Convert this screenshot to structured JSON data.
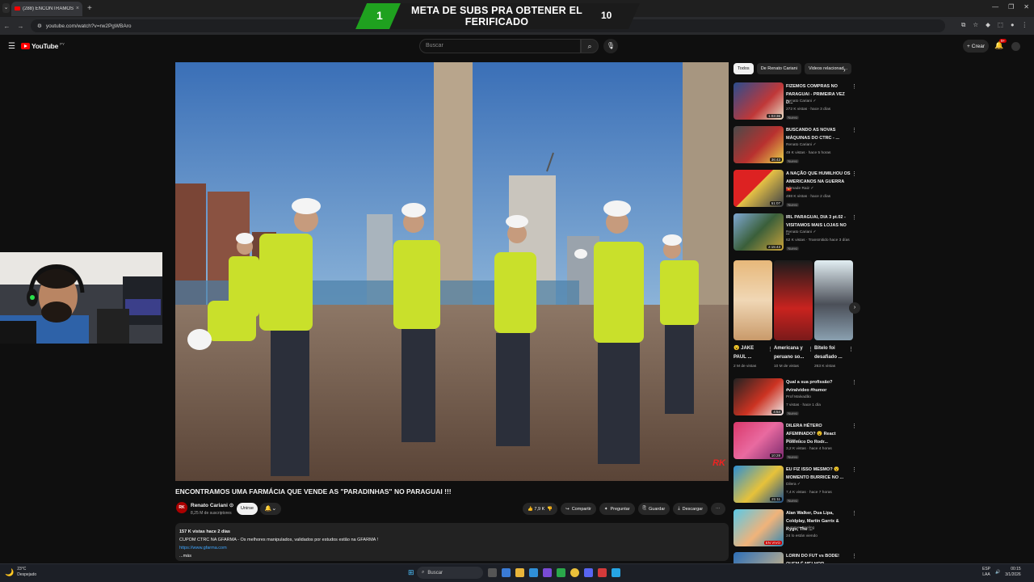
{
  "browser": {
    "tab_title": "(288) ENCONTRAMOS UMA...",
    "tab_close": "×",
    "new_tab": "+",
    "tab_menu": "⌄",
    "url": "youtube.com/watch?v=rw2PgWBAro",
    "window_controls": [
      "—",
      "❐",
      "✕"
    ]
  },
  "overlay": {
    "left_number": "1",
    "title": "META DE SUBS PRA OBTENER EL FERIFICADO",
    "right_number": "10"
  },
  "youtube": {
    "logo_text": "YouTube",
    "country_code": "PY",
    "search_placeholder": "Buscar",
    "create_label": "Crear",
    "notification_count": "9+"
  },
  "video": {
    "watermark": "RK",
    "title": "ENCONTRAMOS UMA FARMÁCIA QUE VENDE AS \"PARADINHAS\" NO PARAGUAI !!!",
    "channel_initials": "RK",
    "channel_name": "Renato Cariani",
    "channel_subs": "8,25 M de suscriptores",
    "join_label": "Unirse",
    "like_count": "7,9 K",
    "share_label": "Compartir",
    "ask_label": "Preguntar",
    "save_label": "Guardar",
    "download_label": "Descargar",
    "description": {
      "stats": "157 K vistas  hace 2 días",
      "line1": "CUPOM CTRC NA GFARMA - Os melhores manipulados, validados por estudos estão na GFARMA !",
      "link": "https://www.gfarma.com",
      "more": "...más"
    }
  },
  "sidebar": {
    "chips": [
      "Todos",
      "De Renato Cariani",
      "Videos relacionad..."
    ],
    "recommendations": [
      {
        "title": "FIZEMOS COMPRAS NO PARAGUAI - PRIMEIRA VEZ D...",
        "channel": "Renato Cariani ✓",
        "views": "272 K vistas · hace 3 días",
        "badge": "Nuevo",
        "duration": "1:03:36"
      },
      {
        "title": "BUSCANDO AS NOVAS MÁQUINAS DO CTRC - ...",
        "channel": "Renato Cariani ✓",
        "views": "49 K vistas · hace 5 horas",
        "badge": "Nuevo",
        "duration": "36:43"
      },
      {
        "title": "A NAÇÃO QUE HUMILHOU OS AMERICANOS NA GUERRA 🇻🇳",
        "channel": "Nômade Raiz ✓",
        "views": "498 K vistas · hace 2 días",
        "badge": "Nuevo",
        "duration": "51:07"
      },
      {
        "title": "IRL PARAGUAI, DIA 3 pt.02 - VISITAMOS MAIS LOJAS NO ...",
        "channel": "Renato Cariani ✓",
        "views": "62 K vistas · Transmitido hace 3 días",
        "badge": "Nuevo",
        "duration": "2:15:43"
      }
    ],
    "shorts": [
      {
        "title": "😮 JAKE PAUL ...",
        "views": "2 M de vistas"
      },
      {
        "title": "Americana y peruano so...",
        "views": "10 M de vistas"
      },
      {
        "title": "Bitelo foi desafiado ...",
        "views": "263 K vistas"
      }
    ],
    "recommendations2": [
      {
        "title": "Qual a sua profissão? #viralvideo #humor",
        "channel": "Prof Malvadão",
        "views": "7 vistas · hace 1 día",
        "badge": "Nuevo",
        "duration": "4:54"
      },
      {
        "title": "DILERA HÉTERO AFEMINADO? 😮 React Polêmico Do Rodr...",
        "channel": "Dilera ✓",
        "views": "3,2 K vistas · hace 4 horas",
        "badge": "Nuevo",
        "duration": "10:28"
      },
      {
        "title": "EU FIZ ISSO MESMO? 😮 MOMENTO BURRICE NO ...",
        "channel": "Dilera ✓",
        "views": "7,4 K vistas · hace 7 horas",
        "badge": "Nuevo",
        "duration": "21:11"
      },
      {
        "title": "Alan Walker, Dua Lipa, Coldplay, Martin Garrix & Kygo, The ...",
        "channel": "Summer Feeling",
        "views": "24 lo están viendo",
        "badge": "",
        "duration": "EN VIVO"
      },
      {
        "title": "LORIN DO FUT vs BODE! QUEM É MELHOR BEIJADOR...",
        "channel": "",
        "views": "",
        "badge": "",
        "duration": ""
      }
    ]
  },
  "taskbar": {
    "temp": "23°C",
    "weather": "Despejado",
    "search": "Buscar",
    "lang1": "ESP",
    "lang2": "LAA",
    "time": "00:15",
    "date": "3/1/2026"
  },
  "colors": {
    "yt_red": "#ff0000",
    "overlay_green": "#1fa11f",
    "link_blue": "#3ea6ff"
  }
}
